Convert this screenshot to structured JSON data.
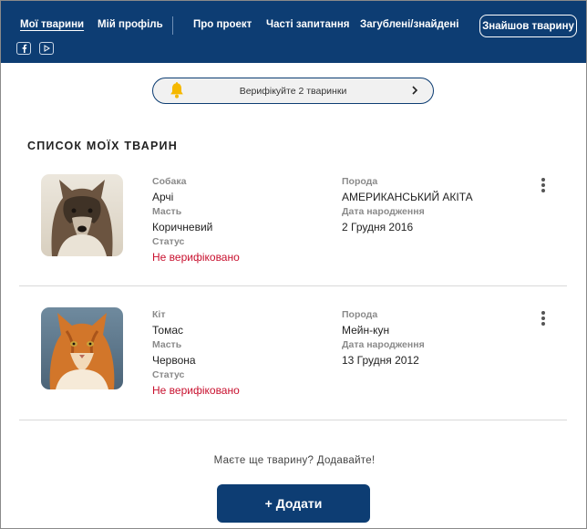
{
  "nav": {
    "items": [
      {
        "label": "Мої тварини",
        "active": true
      },
      {
        "label": "Мій профіль",
        "active": false
      },
      {
        "label": "Про проект",
        "active": false
      },
      {
        "label": "Часті запитання",
        "active": false
      },
      {
        "label": "Загублені/знайдені",
        "active": false
      }
    ],
    "found_button": "Знайшов тварину",
    "social": [
      "facebook-icon",
      "youtube-icon"
    ]
  },
  "verify_banner": {
    "text": "Верифікуйте 2 тваринки",
    "icon": "bell-icon"
  },
  "section_title": "СПИСОК МОЇХ ТВАРИН",
  "labels": {
    "color": "Масть",
    "status": "Статус",
    "breed": "Порода",
    "birth_date": "Дата народження"
  },
  "animals": [
    {
      "species": "Собака",
      "name": "Арчі",
      "color": "Коричневий",
      "status": "Не верифіковано",
      "breed": "АМЕРИКАНСЬКИЙ АКІТА",
      "birth_date": "2 Грудня 2016"
    },
    {
      "species": "Кіт",
      "name": "Томас",
      "color": "Червона",
      "status": "Не верифіковано",
      "breed": "Мейн-кун",
      "birth_date": "13 Грудня 2012"
    }
  ],
  "add_prompt": "Маєте ще тварину? Додавайте!",
  "add_button": "+ Додати",
  "colors": {
    "primary": "#0d3d73",
    "status_unverified": "#c8102e",
    "bell": "#f5b800"
  }
}
